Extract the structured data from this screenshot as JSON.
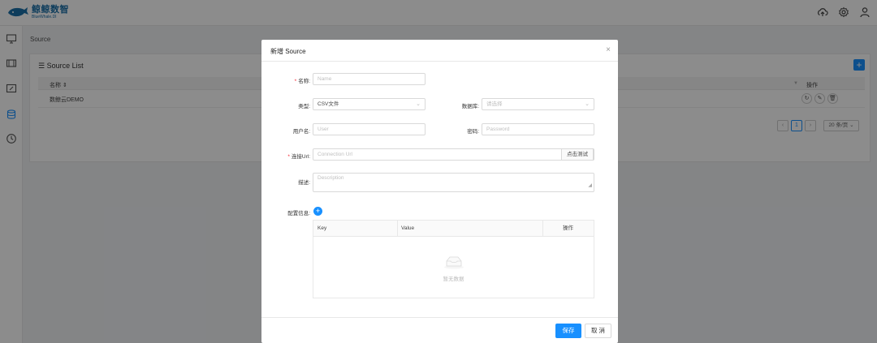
{
  "brand": {
    "name_cn": "鲸鲸数智",
    "name_en": "BlueWhale.DI",
    "color": "#1b6fa8"
  },
  "topbar": {
    "icons": [
      "cloud-upload-icon",
      "gear-icon",
      "user-icon"
    ]
  },
  "sidebar": {
    "icons": [
      "monitor-icon",
      "film-icon",
      "edit-board-icon",
      "database-icon",
      "clock-icon"
    ],
    "active_color": "#1890ff"
  },
  "main": {
    "breadcrumb": "Source",
    "card_title": "☰ Source List",
    "add_label": "+",
    "table": {
      "columns": {
        "name": "名称 ⇕",
        "filter": "▼",
        "actions": "操作"
      },
      "rows": [
        {
          "name": "数鲸云DEMO"
        }
      ],
      "row_action_glyphs": [
        "↻",
        "✎",
        "🗑"
      ]
    },
    "pagination": {
      "prev": "‹",
      "current": "1",
      "next": "›",
      "page_size": "20 条/页 ⌄"
    }
  },
  "modal": {
    "title": "新增 Source",
    "close": "×",
    "form": {
      "name": {
        "label": "名称:",
        "required": "*",
        "placeholder": "Name",
        "value": ""
      },
      "type": {
        "label": "类型:",
        "value": "CSV文件",
        "chevron": "⌄"
      },
      "database": {
        "label": "数据库:",
        "placeholder": "请选择",
        "value": "",
        "chevron": "⌄"
      },
      "username": {
        "label": "用户名:",
        "placeholder": "User",
        "value": ""
      },
      "password": {
        "label": "密码:",
        "placeholder": "Password",
        "value": ""
      },
      "url": {
        "label": "连接Url:",
        "required": "*",
        "placeholder": "Connection Url",
        "value": "",
        "test_button": "点击测试"
      },
      "description": {
        "label": "描述:",
        "placeholder": "Description",
        "value": ""
      },
      "config": {
        "label": "配置信息:",
        "add": "+"
      }
    },
    "config_table": {
      "columns": {
        "key": "Key",
        "value": "Value",
        "actions": "操作"
      },
      "empty_text": "暂无数据"
    },
    "footer": {
      "save": "保存",
      "cancel": "取 消"
    }
  },
  "colors": {
    "primary": "#1890ff",
    "required": "#f5222d",
    "mask": "rgba(0,0,0,0.45)"
  }
}
